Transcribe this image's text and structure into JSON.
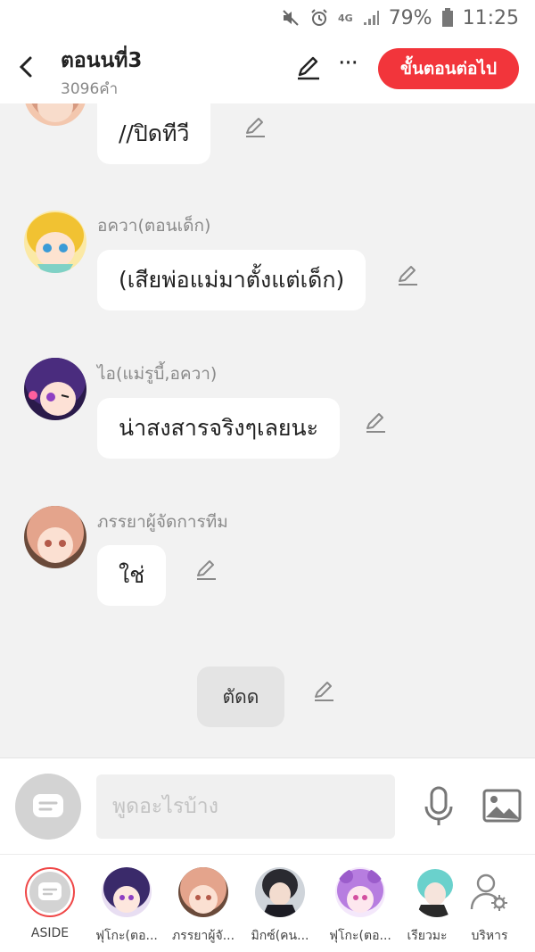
{
  "status_bar": {
    "battery": "79%",
    "time": "11:25",
    "network": "4G"
  },
  "header": {
    "title": "ตอนนที่3",
    "word_count": "3096คำ",
    "next_step_label": "ขั้นตอนต่อไป",
    "accent_color": "#f2353b"
  },
  "messages": [
    {
      "type": "bubble",
      "speaker": "",
      "text": "//ปิดทีวี"
    },
    {
      "type": "bubble",
      "speaker": "อควา(ตอนเด็ก)",
      "text": "(เสียพ่อแม่มาตั้งแต่เด็ก)"
    },
    {
      "type": "bubble",
      "speaker": "ไอ(แม่รูบี้,อควา)",
      "text": "น่าสงสารจริงๆเลยนะ"
    },
    {
      "type": "bubble",
      "speaker": "ภรรยาผู้จัดการทีม",
      "text": "ใช่"
    },
    {
      "type": "narration",
      "text": "ตัดด"
    }
  ],
  "input": {
    "placeholder": "พูดอะไรบ้าง"
  },
  "characters": [
    {
      "label": "ASIDE",
      "kind": "aside"
    },
    {
      "label": "ฟุโกะ(ตอ..."
    },
    {
      "label": "ภรรยาผู้จั..."
    },
    {
      "label": "มิกซ์(คน..."
    },
    {
      "label": "ฟุโกะ(ตอ..."
    },
    {
      "label": "เรียวมะ"
    },
    {
      "label": "บริหาร",
      "kind": "manage"
    }
  ]
}
